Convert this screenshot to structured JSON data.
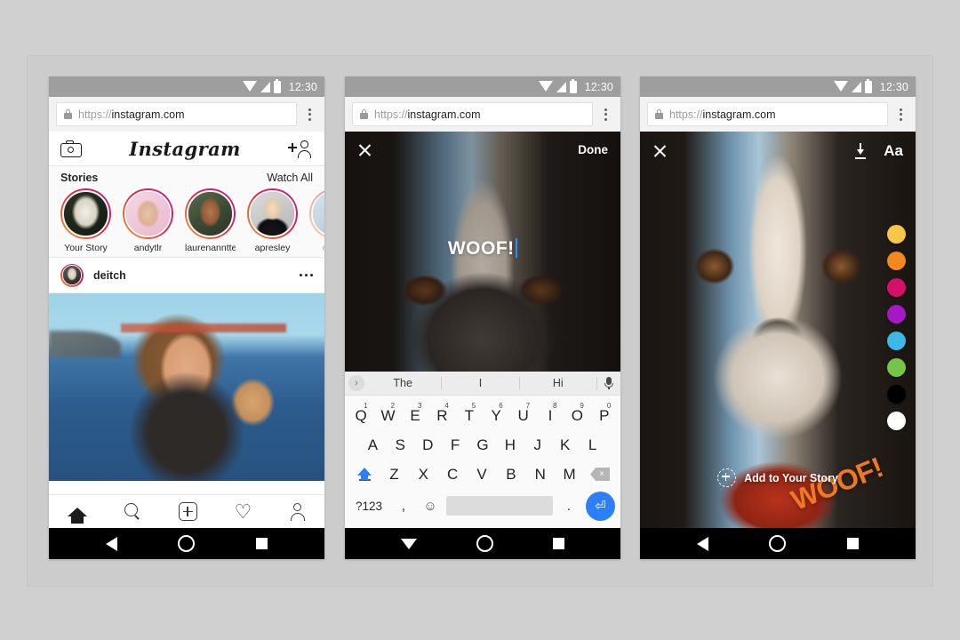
{
  "canvas": {
    "background_color": "#d0d0d0",
    "panel_color": "#cccccc"
  },
  "status_bar": {
    "time": "12:30"
  },
  "browser": {
    "url_scheme": "https://",
    "url_host": "instagram.com"
  },
  "phone1": {
    "app_header": {
      "logo": "Instagram"
    },
    "stories": {
      "title": "Stories",
      "watch_all": "Watch All",
      "items": [
        {
          "label": "Your Story",
          "faded": false
        },
        {
          "label": "andytlr",
          "faded": false
        },
        {
          "label": "laurenanntte",
          "faded": false
        },
        {
          "label": "apresley",
          "faded": false
        },
        {
          "label": "ewtha",
          "faded": true
        }
      ]
    },
    "post": {
      "username": "deitch"
    },
    "tabbar": {
      "home": "home-tab",
      "search": "search-tab",
      "add": "add-tab",
      "activity": "activity-tab",
      "profile": "profile-tab",
      "heart_glyph": "♡"
    }
  },
  "phone2": {
    "topbar": {
      "done_label": "Done"
    },
    "caption_text": "WOOF!",
    "keyboard": {
      "suggestions": [
        "The",
        "I",
        "Hi"
      ],
      "row1": [
        {
          "letter": "Q",
          "num": "1"
        },
        {
          "letter": "W",
          "num": "2"
        },
        {
          "letter": "E",
          "num": "3"
        },
        {
          "letter": "R",
          "num": "4"
        },
        {
          "letter": "T",
          "num": "5"
        },
        {
          "letter": "Y",
          "num": "6"
        },
        {
          "letter": "U",
          "num": "7"
        },
        {
          "letter": "I",
          "num": "8"
        },
        {
          "letter": "O",
          "num": "9"
        },
        {
          "letter": "P",
          "num": "0"
        }
      ],
      "row2": [
        "A",
        "S",
        "D",
        "F",
        "G",
        "H",
        "J",
        "K",
        "L"
      ],
      "row3": [
        "Z",
        "X",
        "C",
        "V",
        "B",
        "N",
        "M"
      ],
      "numeric_key": "?123",
      "comma_key": ",",
      "emoji_key": "☺",
      "period_key": ".",
      "enter_glyph": "⏎",
      "expand_glyph": "›",
      "delete_glyph": "×"
    }
  },
  "phone3": {
    "topbar": {
      "text_tool_label": "Aa"
    },
    "palette": [
      {
        "name": "yellow",
        "hex": "#f7c64a"
      },
      {
        "name": "orange",
        "hex": "#f5871f"
      },
      {
        "name": "pink",
        "hex": "#d4106a"
      },
      {
        "name": "purple",
        "hex": "#a518c6"
      },
      {
        "name": "light-blue",
        "hex": "#3cb9e8"
      },
      {
        "name": "green",
        "hex": "#76c44a"
      },
      {
        "name": "black",
        "hex": "#000000"
      },
      {
        "name": "white",
        "hex": "#ffffff"
      }
    ],
    "sticker_text": "WOOF!",
    "sticker_color": "#f07822",
    "add_to_story_label": "Add to Your Story"
  }
}
